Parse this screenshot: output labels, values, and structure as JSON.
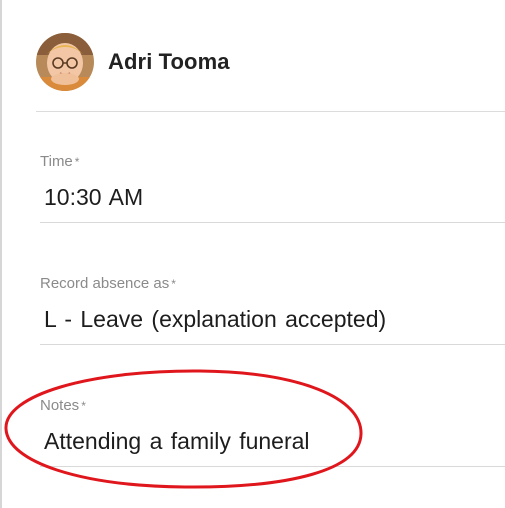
{
  "student": {
    "name": "Adri Tooma",
    "avatar_icon": "student-photo-avatar"
  },
  "fields": {
    "time": {
      "label": "Time",
      "required_marker": "*",
      "value": "10:30 AM"
    },
    "record_absence": {
      "label": "Record absence as",
      "required_marker": "*",
      "value": "L - Leave (explanation accepted)"
    },
    "notes": {
      "label": "Notes",
      "required_marker": "*",
      "value": "Attending a family funeral"
    }
  },
  "colors": {
    "highlight": "#e0161d",
    "label": "#8a8a8a",
    "divider": "#d9d9d9"
  }
}
